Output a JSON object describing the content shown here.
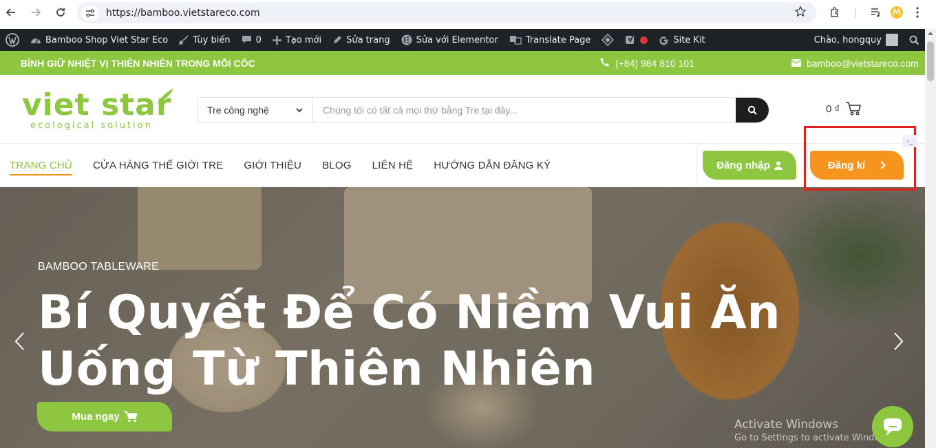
{
  "browser": {
    "url": "https://bamboo.vietstareco.com"
  },
  "admin_bar": {
    "site_name": "Bamboo Shop Viet Star Eco",
    "customize": "Tùy biến",
    "comments_count": "0",
    "new": "Tạo mới",
    "edit_page": "Sửa trang",
    "edit_elementor": "Sửa với Elementor",
    "translate": "Translate Page",
    "site_kit": "Site Kit",
    "greeting": "Chào, hongquy"
  },
  "top_strip": {
    "tagline": "BÌNH GIỮ NHIỆT VỊ THIÊN NHIÊN TRONG MỖI CỐC",
    "phone": "(+84) 984 810 101",
    "email": "bamboo@vietstareco.com"
  },
  "header": {
    "logo_main": "viet star",
    "logo_sub": "ecological solution",
    "search_category": "Tre công nghệ",
    "search_placeholder": "Chúng tôi có tất cả mọi thứ bằng Tre tại đây...",
    "cart_total": "0 ₫"
  },
  "nav": {
    "items": [
      {
        "label": "TRANG CHỦ"
      },
      {
        "label": "CỬA HÀNG THẾ GIỚI TRE"
      },
      {
        "label": "GIỚI THIỆU"
      },
      {
        "label": "BLOG"
      },
      {
        "label": "LIÊN HỆ"
      },
      {
        "label": "HƯỚNG DẪN ĐĂNG KÝ"
      }
    ],
    "login_label": "Đăng nhập",
    "register_label": "Đăng kí"
  },
  "hero": {
    "tag": "BAMBOO TABLEWARE",
    "title": "Bí Quyết Để Có Niềm Vui Ăn Uống Từ Thiên Nhiên",
    "button_label": "Mua ngay"
  },
  "watermark": {
    "line1": "Activate Windows",
    "line2": "Go to Settings to activate Windows."
  },
  "colors": {
    "brand_green": "#8dc63f",
    "brand_orange": "#f7941d",
    "highlight_red": "#e0201b"
  }
}
